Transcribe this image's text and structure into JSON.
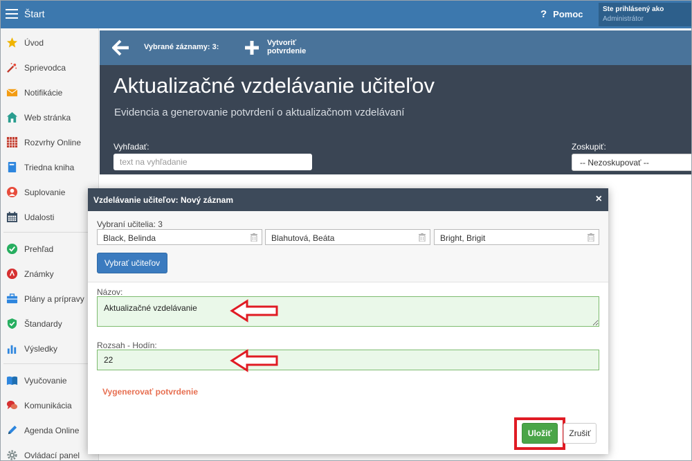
{
  "topbar": {
    "title": "Štart",
    "help_label": "Pomoc",
    "user_line1": "Ste prihlásený ako",
    "user_line2": "Administrátor",
    "color": "#3c78ae"
  },
  "sidebar": {
    "items": [
      {
        "label": "Úvod",
        "icon": "star-icon"
      },
      {
        "label": "Sprievodca",
        "icon": "magic-wand-icon"
      },
      {
        "label": "Notifikácie",
        "icon": "envelope-icon"
      },
      {
        "label": "Web stránka",
        "icon": "house-icon"
      },
      {
        "label": "Rozvrhy Online",
        "icon": "timetable-grid-icon"
      },
      {
        "label": "Triedna kniha",
        "icon": "book-icon"
      },
      {
        "label": "Suplovanie",
        "icon": "person-icon"
      },
      {
        "label": "Udalosti",
        "icon": "calendar-icon"
      },
      {
        "label": "Prehľad",
        "icon": "check-circle-icon"
      },
      {
        "label": "Známky",
        "icon": "grade-icon"
      },
      {
        "label": "Plány a prípravy",
        "icon": "briefcase-icon"
      },
      {
        "label": "Štandardy",
        "icon": "shield-check-icon"
      },
      {
        "label": "Výsledky",
        "icon": "bar-chart-icon"
      },
      {
        "label": "Vyučovanie",
        "icon": "open-book-icon"
      },
      {
        "label": "Komunikácia",
        "icon": "chat-bubbles-icon"
      },
      {
        "label": "Agenda Online",
        "icon": "pen-icon"
      },
      {
        "label": "Ovládací panel",
        "icon": "gear-icon"
      }
    ]
  },
  "toolbar": {
    "selected_records": "Vybrané záznamy: 3:",
    "create_line1": "Vytvoriť",
    "create_line2": "potvrdenie"
  },
  "header": {
    "title": "Aktualizačné vzdelávanie učiteľov",
    "subtitle": "Evidencia a generovanie potvrdení o aktualizačnom vzdelávaní",
    "search_label": "Vyhľadať:",
    "search_placeholder": "text na vyhľadanie",
    "group_label": "Zoskupiť:",
    "group_value": "-- Nezoskupovať --",
    "color": "#3a4554"
  },
  "modal": {
    "title": "Vzdelávanie učiteľov: Nový záznam",
    "close_symbol": "×",
    "teachers_label": "Vybraní učitelia: 3",
    "teachers": [
      "Black, Belinda",
      "Blahutová, Beáta",
      "Bright, Brigit"
    ],
    "pick_teachers_button": "Vybrať učiteľov",
    "name_label": "Názov:",
    "name_value": "Aktualizačné vzdelávanie",
    "hours_label": "Rozsah - Hodín:",
    "hours_value": "22",
    "generate_link": "Vygenerovať potvrdenie",
    "save_button": "Uložiť",
    "cancel_button": "Zrušiť",
    "save_color": "#4aa548",
    "highlight_color": "#e01b24"
  }
}
